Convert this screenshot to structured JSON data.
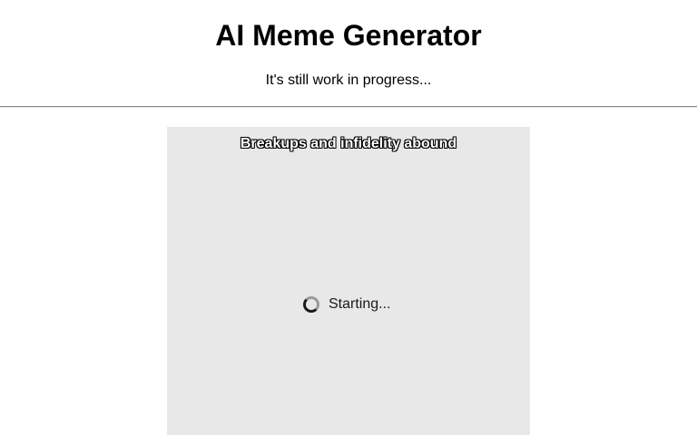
{
  "header": {
    "title": "AI Meme Generator",
    "subtitle": "It's still work in progress..."
  },
  "meme": {
    "caption": "Breakups and infidelity abound",
    "status_text": "Starting...",
    "status_icon": "spinner-icon",
    "background_color": "#e8e8e8"
  }
}
